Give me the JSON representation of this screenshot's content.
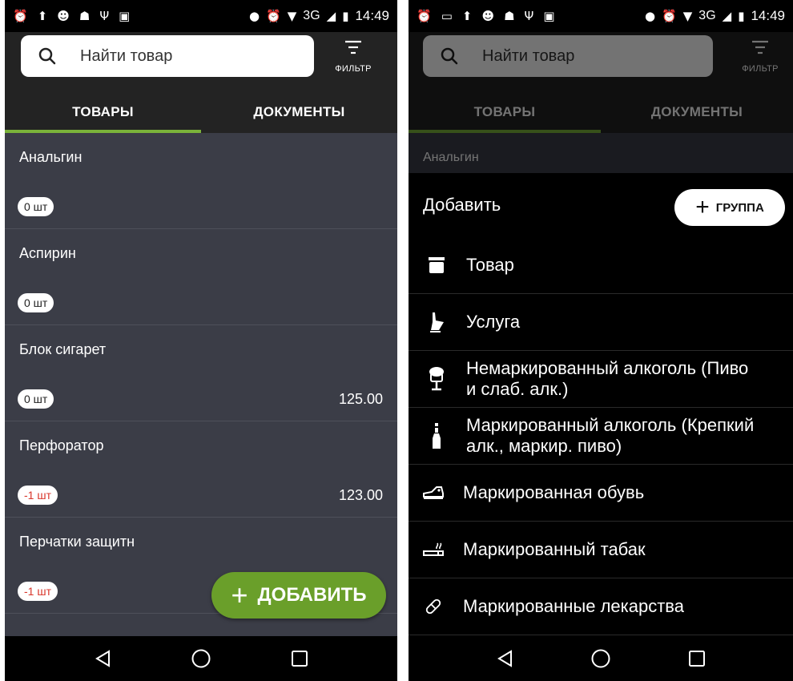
{
  "status_bar": {
    "left_icons": [
      "alarm-icon",
      "upload-icon",
      "android-icon",
      "android-icon",
      "usb-icon",
      "image-icon"
    ],
    "right_icons": [
      "location-icon",
      "alarm-icon",
      "wifi-icon",
      "signal-icon",
      "battery-icon"
    ],
    "network": "3G",
    "time": "14:49"
  },
  "search": {
    "placeholder": "Найти товар"
  },
  "filter": {
    "label": "ФИЛЬТР"
  },
  "tabs": [
    {
      "label": "ТОВАРЫ",
      "active": true
    },
    {
      "label": "ДОКУМЕНТЫ",
      "active": false
    }
  ],
  "products": [
    {
      "name": "Анальгин",
      "qty": "0 шт",
      "price": ""
    },
    {
      "name": "Аспирин",
      "qty": "0 шт",
      "price": ""
    },
    {
      "name": "Блок сигарет",
      "qty": "0 шт",
      "price": "125.00"
    },
    {
      "name": "Перфоратор",
      "qty": "-1 шт",
      "price": "123.00"
    },
    {
      "name": "Перчатки защитн",
      "qty": "-1 шт",
      "price": ""
    }
  ],
  "fab": {
    "label": "ДОБАВИТЬ"
  },
  "add_sheet": {
    "title": "Добавить",
    "group_button": "ГРУППА",
    "items": [
      {
        "icon": "box-icon",
        "label": "Товар"
      },
      {
        "icon": "service-hand-icon",
        "label": "Услуга"
      },
      {
        "icon": "beer-glass-icon",
        "line1": "Немаркированный алкоголь (Пиво",
        "line2": "и слаб. алк.)"
      },
      {
        "icon": "bottle-icon",
        "line1": "Маркированный алкоголь (Крепкий",
        "line2": "алк., маркир. пиво)"
      },
      {
        "icon": "shoe-icon",
        "label": "Маркированная обувь"
      },
      {
        "icon": "cigarette-icon",
        "label": "Маркированный табак"
      },
      {
        "icon": "pill-icon",
        "label": "Маркированные лекарства"
      }
    ]
  },
  "colors": {
    "accent": "#7ab33a",
    "fab": "#6a9f2a",
    "list_bg": "#3b3d47",
    "header_bg": "#232323",
    "negative": "#d9362b"
  }
}
